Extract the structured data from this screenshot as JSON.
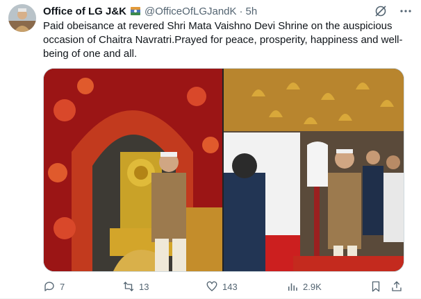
{
  "tweet": {
    "author_name": "Office of LG J&K",
    "handle": "@OfficeOfLGJandK",
    "separator": "·",
    "time": "5h",
    "text": "Paid obeisance at revered Shri Mata Vaishno Devi Shrine on the auspicious occasion of Chaitra Navratri.Prayed for peace, prosperity, happiness and well-being of one and all."
  },
  "header_icons": [
    "grok-icon",
    "more-icon"
  ],
  "media": {
    "photos": [
      {
        "name": "photo-shrine-floral-arch"
      },
      {
        "name": "photo-shrine-bells-corridor"
      }
    ]
  },
  "actions": {
    "replies": "7",
    "reposts": "13",
    "likes": "143",
    "views": "2.9K"
  },
  "colors": {
    "text_primary": "#0f1419",
    "text_secondary": "#536471",
    "border": "#cfd9de"
  }
}
